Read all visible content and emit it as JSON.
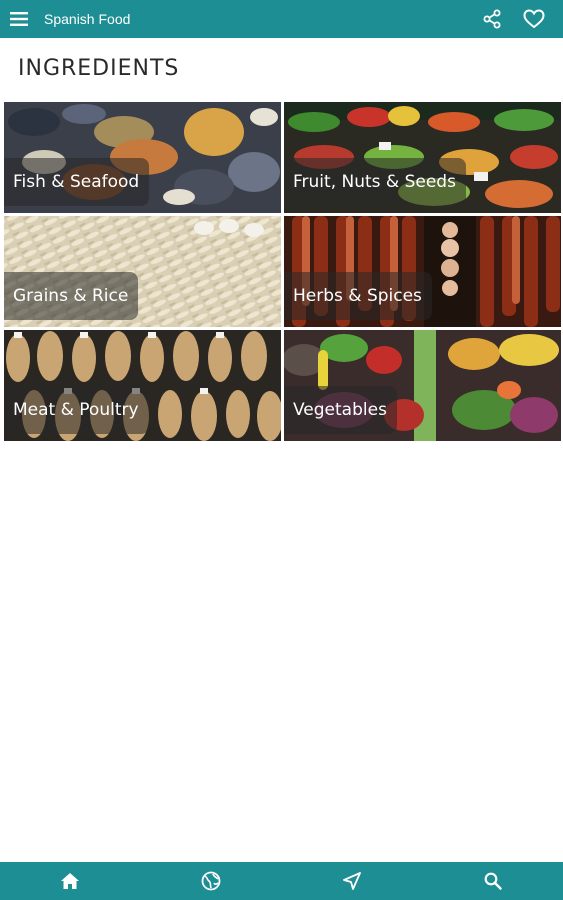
{
  "app_bar": {
    "title": "Spanish Food",
    "menu_icon": "hamburger-menu-icon",
    "share_icon": "share-icon",
    "favorite_icon": "heart-icon"
  },
  "section": {
    "heading": "INGREDIENTS"
  },
  "categories": [
    {
      "label": "Fish & Seafood"
    },
    {
      "label": "Fruit, Nuts & Seeds"
    },
    {
      "label": "Grains & Rice"
    },
    {
      "label": "Herbs & Spices"
    },
    {
      "label": "Meat & Poultry"
    },
    {
      "label": "Vegetables"
    }
  ],
  "bottom_nav": [
    "home-icon",
    "globe-icon",
    "navigation-arrow-icon",
    "search-icon"
  ],
  "colors": {
    "primary": "#1d8e93",
    "label_overlay": "#282828",
    "text_on_primary": "#ffffff"
  }
}
